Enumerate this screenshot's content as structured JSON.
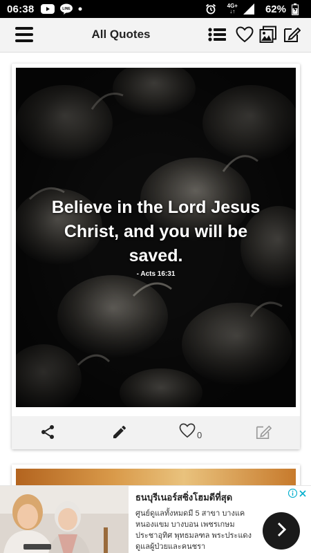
{
  "status_bar": {
    "time": "06:38",
    "network": "4G+",
    "battery": "62%",
    "icons": [
      "youtube-icon",
      "line-icon",
      "dot-icon",
      "alarm-icon",
      "signal-icon",
      "battery-icon"
    ]
  },
  "toolbar": {
    "title": "All Quotes",
    "icons": [
      "menu-icon",
      "list-icon",
      "heart-icon",
      "gallery-icon",
      "edit-icon"
    ]
  },
  "quote_card": {
    "text": "Believe in the Lord Jesus Christ, and you will be saved.",
    "reference": "- Acts 16:31",
    "like_count": "0",
    "actions": [
      "share-icon",
      "pencil-icon",
      "heart-outline-icon",
      "edit-icon"
    ]
  },
  "ad": {
    "title": "ธนบุรีเนอร์สซิ่งโฮมดีที่สุด",
    "body": "ศูนย์ดูแลทั้งหมดมี 5 สาขา บางแค หนองแขม บางบอน เพชรเกษม ประชาอุทิศ พุทธมลฑล พระประแดง ดูแลผู้ป่วยและคนชรา",
    "icons": [
      "ad-choices-icon",
      "close-icon",
      "chevron-right-icon"
    ]
  },
  "colors": {
    "status_bar": "#000000",
    "toolbar_bg": "#f3f3f3",
    "card_actions_bg": "#f2f2f2",
    "quote_text": "#ffffff",
    "ad_cta": "#1a1a1a",
    "ad_choices": "#00aecd"
  }
}
